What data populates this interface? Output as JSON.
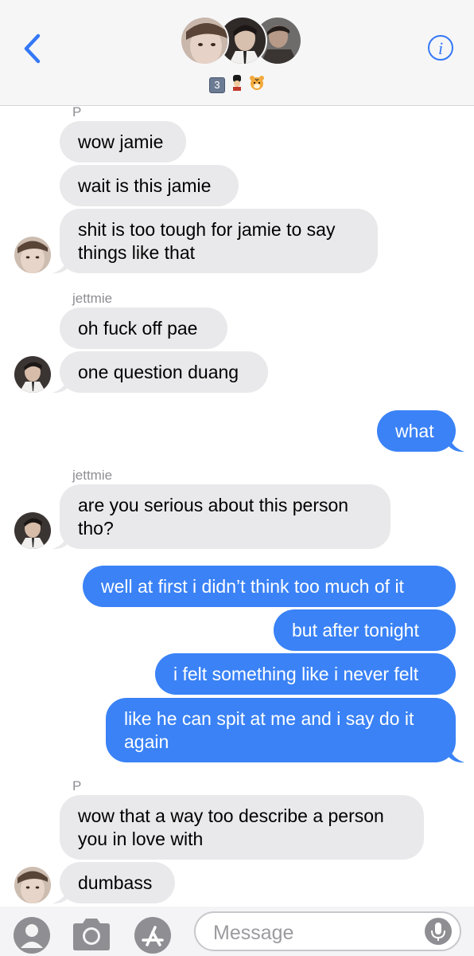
{
  "header": {
    "back_icon": "chevron-left-icon",
    "info_icon": "info-icon",
    "info_label": "i",
    "group_keycap": "3",
    "accent": "#3478f6"
  },
  "messages": [
    {
      "sender_label": "P"
    },
    {
      "text": "wow jamie"
    },
    {
      "text": "wait is this jamie"
    },
    {
      "line1": "shit is too tough for jamie to say",
      "line2": "things like that"
    },
    {
      "sender_label": "jettmie"
    },
    {
      "text": "oh fuck off pae"
    },
    {
      "text": "one question duang"
    },
    {
      "text": "what"
    },
    {
      "sender_label": "jettmie"
    },
    {
      "line1": "are you serious about this person",
      "line2": "tho?"
    },
    {
      "text": "well at first i didn’t think too much of it"
    },
    {
      "text": "but after tonight"
    },
    {
      "text": "i felt something like i never felt"
    },
    {
      "line1": "like he can spit at me and i say do it",
      "line2": "again"
    },
    {
      "sender_label": "P"
    },
    {
      "line1": "wow that a way too describe a person",
      "line2": "you in love with"
    },
    {
      "text": "dumbass"
    }
  ],
  "composer": {
    "placeholder": "Message",
    "contact_icon": "person-icon",
    "camera_icon": "camera-icon",
    "apps_icon": "app-store-icon",
    "mic_icon": "microphone-icon"
  },
  "colors": {
    "incoming_bubble": "#e9e9eb",
    "outgoing_bubble": "#3a82f6",
    "header_bg": "#f6f6f7"
  }
}
